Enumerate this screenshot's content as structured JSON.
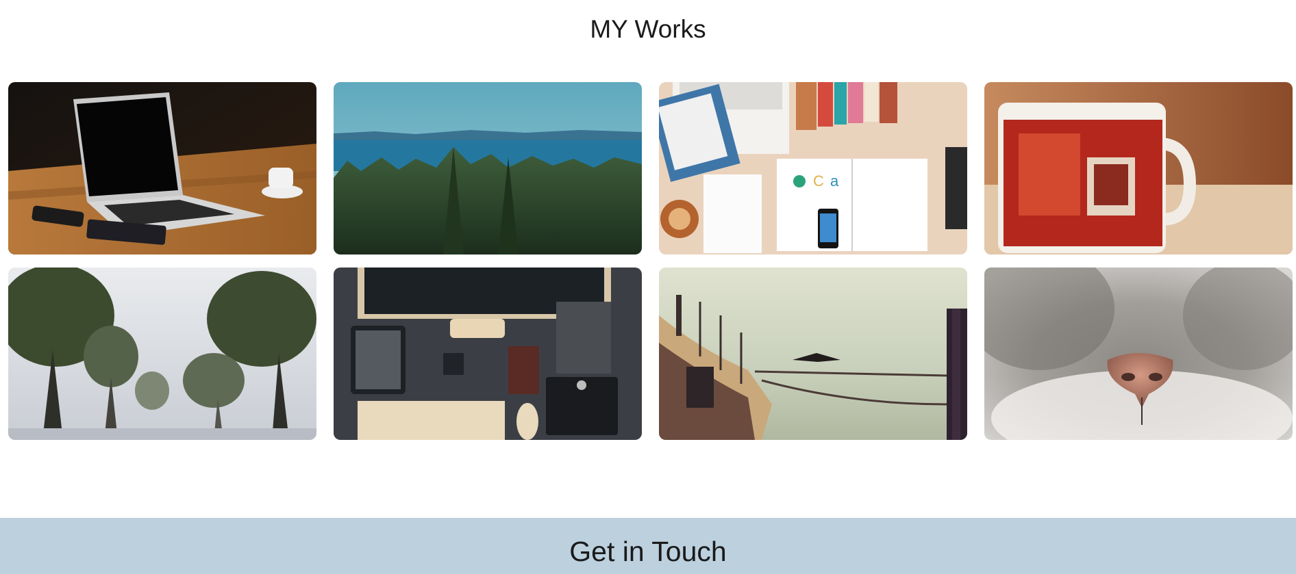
{
  "works": {
    "title": "MY Works",
    "items": [
      {
        "subject": "laptop-on-wooden-table"
      },
      {
        "subject": "forest-and-sea-landscape"
      },
      {
        "subject": "desk-flatlay-with-books"
      },
      {
        "subject": "vintage-red-mug"
      },
      {
        "subject": "foggy-tree-lined-road"
      },
      {
        "subject": "dark-desk-workspace"
      },
      {
        "subject": "pier-with-cormorant"
      },
      {
        "subject": "cat-nose-closeup"
      }
    ]
  },
  "contact": {
    "title": "Get in Touch"
  }
}
